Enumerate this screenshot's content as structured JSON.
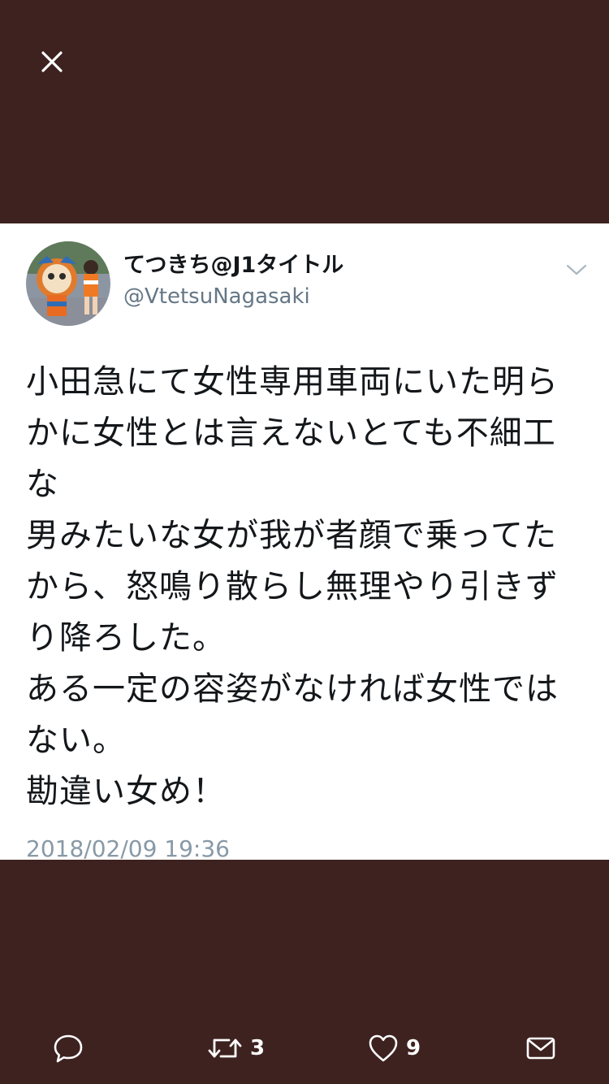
{
  "header": {
    "close_icon": "close-icon"
  },
  "tweet": {
    "display_name": "てつきち@J1タイトル",
    "handle": "@VtetsuNagasaki",
    "text": "小田急にて女性専用車両にいた明らかに女性とは言えないとても不細工な\n男みたいな女が我が者顔で乗ってたから、怒鳴り散らし無理やり引きずり降ろした。\nある一定の容姿がなければ女性ではない。\n勘違い女め！",
    "timestamp": "2018/02/09 19:36",
    "avatar_icon": "avatar",
    "caret_icon": "chevron-down-icon"
  },
  "actions": {
    "reply_icon": "reply-icon",
    "retweet_icon": "retweet-icon",
    "retweet_count": "3",
    "like_icon": "heart-icon",
    "like_count": "9",
    "message_icon": "mail-icon"
  },
  "colors": {
    "backdrop": "#3d2220",
    "card": "#ffffff",
    "text": "#14171a",
    "muted": "#657786",
    "icon": "#ffffff"
  }
}
